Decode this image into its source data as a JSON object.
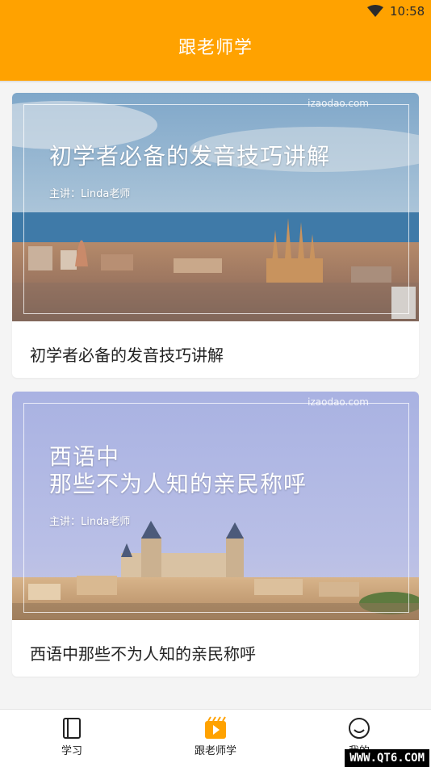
{
  "status_bar": {
    "time": "10:58"
  },
  "header": {
    "title": "跟老师学"
  },
  "courses": [
    {
      "banner_title_lines": [
        "初学者必备的发音技巧讲解"
      ],
      "speaker": "主讲：Linda老师",
      "watermark": "izaodao.com",
      "caption": "初学者必备的发音技巧讲解"
    },
    {
      "banner_title_lines": [
        "西语中",
        "那些不为人知的亲民称呼"
      ],
      "speaker": "主讲：Linda老师",
      "watermark": "izaodao.com",
      "caption": "西语中那些不为人知的亲民称呼"
    }
  ],
  "tabs": [
    {
      "label": "学习",
      "icon": "book-icon",
      "active": false
    },
    {
      "label": "跟老师学",
      "icon": "play-icon",
      "active": true
    },
    {
      "label": "我的",
      "icon": "smile-icon",
      "active": false
    }
  ],
  "corner_watermark": "WWW.QT6.COM",
  "colors": {
    "accent": "#FFA200"
  }
}
